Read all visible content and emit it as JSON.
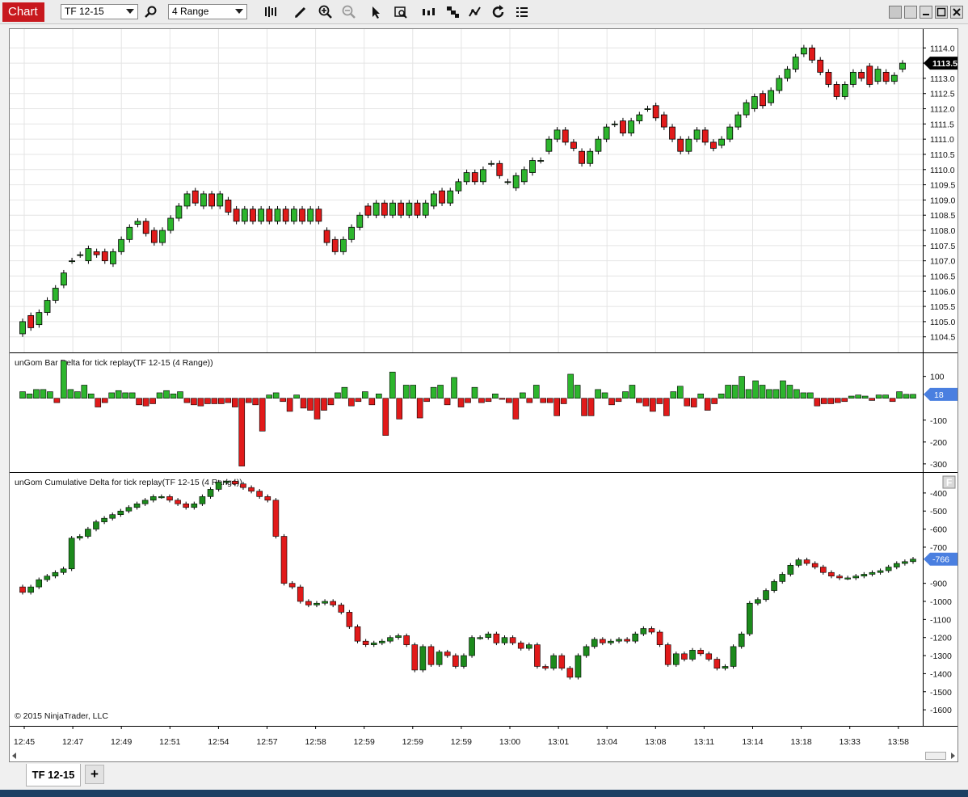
{
  "toolbar": {
    "chart_label": "Chart",
    "instrument": "TF 12-15",
    "period": "4 Range",
    "icons": [
      "search-icon",
      "bars-type-icon",
      "pencil-draw-icon",
      "zoom-in-icon",
      "zoom-out-icon",
      "pointer-icon",
      "data-box-icon",
      "bar-spacing-icon",
      "indicators-icon",
      "strategies-icon",
      "reload-icon",
      "properties-icon"
    ]
  },
  "panels": {
    "price": {
      "axis_labels": [
        "1114.0",
        "1113.5",
        "1113.0",
        "1112.5",
        "1112.0",
        "1111.5",
        "1111.0",
        "1110.5",
        "1110.0",
        "1109.5",
        "1109.0",
        "1108.5",
        "1108.0",
        "1107.5",
        "1107.0",
        "1106.5",
        "1106.0",
        "1105.5",
        "1105.0",
        "1104.5"
      ],
      "last_price": "1113.5"
    },
    "bar_delta": {
      "title": "unGom Bar Delta for tick replay(TF 12-15 (4 Range))",
      "axis_labels": [
        "100",
        "-100",
        "-200",
        "-300"
      ],
      "last_value": "18"
    },
    "cum_delta": {
      "title": "unGom Cumulative Delta for tick replay(TF 12-15 (4 Range))",
      "axis_labels": [
        "-400",
        "-500",
        "-600",
        "-700",
        "-900",
        "-1000",
        "-1100",
        "-1200",
        "-1300",
        "-1400",
        "-1500",
        "-1600"
      ],
      "last_value": "-766",
      "copyright": "© 2015 NinjaTrader, LLC"
    }
  },
  "time_axis": [
    "12:45",
    "12:47",
    "12:49",
    "12:51",
    "12:54",
    "12:57",
    "12:58",
    "12:59",
    "12:59",
    "12:59",
    "13:00",
    "13:01",
    "13:04",
    "13:08",
    "13:11",
    "13:14",
    "13:18",
    "13:33",
    "13:58"
  ],
  "tabs": {
    "active": "TF 12-15",
    "add": "+"
  },
  "colors": {
    "up": "#2db52d",
    "down": "#e11a1a",
    "cum_up": "#1c8a1c",
    "cum_down": "#e11a1a",
    "price_marker": "#000000",
    "indicator_marker": "#4a7fe0",
    "chart_tab": "#c8181e"
  },
  "chart_data": [
    {
      "type": "candlestick",
      "name": "TF 12-15 price",
      "ylim": [
        1104.2,
        1114.3
      ],
      "bar_range": 0.4,
      "close": [
        1105.0,
        1104.8,
        1105.3,
        1105.7,
        1106.1,
        1106.6,
        1107.0,
        1107.2,
        1107.4,
        1107.2,
        1107.0,
        1107.3,
        1107.7,
        1108.1,
        1108.3,
        1107.9,
        1107.6,
        1108.0,
        1108.4,
        1108.8,
        1109.2,
        1108.9,
        1109.2,
        1108.8,
        1109.2,
        1108.6,
        1108.3,
        1108.7,
        1108.3,
        1108.7,
        1108.3,
        1108.7,
        1108.3,
        1108.7,
        1108.3,
        1108.7,
        1108.3,
        1107.6,
        1107.3,
        1107.7,
        1108.1,
        1108.5,
        1108.5,
        1108.9,
        1108.5,
        1108.9,
        1108.5,
        1108.9,
        1108.5,
        1108.9,
        1109.2,
        1108.9,
        1109.3,
        1109.6,
        1109.9,
        1109.6,
        1110.0,
        1110.2,
        1109.8,
        1109.6,
        1109.8,
        1110.0,
        1110.3,
        1110.3,
        1111.0,
        1111.3,
        1110.9,
        1110.7,
        1110.2,
        1110.6,
        1111.0,
        1111.4,
        1111.5,
        1111.2,
        1111.6,
        1111.8,
        1112.0,
        1111.7,
        1111.4,
        1111.0,
        1110.6,
        1111.0,
        1111.3,
        1110.9,
        1110.7,
        1111.0,
        1111.4,
        1111.8,
        1112.2,
        1112.4,
        1112.1,
        1112.6,
        1113.0,
        1113.3,
        1113.7,
        1114.0,
        1113.6,
        1113.2,
        1112.8,
        1112.4,
        1112.8,
        1113.2,
        1113.0,
        1112.8,
        1113.3,
        1112.9,
        1113.1,
        1113.5
      ],
      "open": [
        1104.6,
        1105.2,
        1104.9,
        1105.3,
        1105.7,
        1106.2,
        1107.0,
        1107.2,
        1107.0,
        1107.3,
        1107.3,
        1106.9,
        1107.3,
        1107.7,
        1108.2,
        1108.3,
        1108.0,
        1107.6,
        1108.0,
        1108.4,
        1108.8,
        1109.3,
        1108.8,
        1109.2,
        1108.8,
        1109.0,
        1108.7,
        1108.3,
        1108.7,
        1108.3,
        1108.7,
        1108.3,
        1108.7,
        1108.3,
        1108.7,
        1108.3,
        1108.7,
        1108.0,
        1107.7,
        1107.3,
        1107.7,
        1108.1,
        1108.8,
        1108.5,
        1108.9,
        1108.5,
        1108.9,
        1108.5,
        1108.9,
        1108.5,
        1108.8,
        1109.3,
        1108.9,
        1109.3,
        1109.6,
        1109.9,
        1109.6,
        1110.2,
        1110.2,
        1109.6,
        1109.4,
        1109.6,
        1109.9,
        1110.3,
        1110.6,
        1111.0,
        1111.3,
        1110.9,
        1110.6,
        1110.2,
        1110.6,
        1111.0,
        1111.5,
        1111.6,
        1111.2,
        1111.6,
        1112.0,
        1112.1,
        1111.8,
        1111.4,
        1111.0,
        1110.6,
        1111.0,
        1111.3,
        1110.9,
        1110.8,
        1111.0,
        1111.4,
        1111.8,
        1112.0,
        1112.5,
        1112.2,
        1112.6,
        1113.0,
        1113.3,
        1113.8,
        1114.0,
        1113.6,
        1113.2,
        1112.8,
        1112.4,
        1112.8,
        1113.2,
        1113.4,
        1112.9,
        1113.2,
        1112.9,
        1113.3
      ]
    },
    {
      "type": "bar",
      "name": "unGom Bar Delta",
      "ylim": [
        -330,
        180
      ],
      "values": [
        30,
        20,
        40,
        40,
        30,
        -20,
        170,
        40,
        30,
        60,
        20,
        -40,
        -20,
        25,
        35,
        25,
        25,
        -30,
        -35,
        -25,
        25,
        35,
        20,
        30,
        -20,
        -30,
        -35,
        -25,
        -25,
        -25,
        -20,
        -40,
        -310,
        -20,
        -30,
        -150,
        15,
        25,
        -15,
        -60,
        15,
        -45,
        -55,
        -95,
        -55,
        -30,
        25,
        50,
        -35,
        -15,
        30,
        -30,
        20,
        -170,
        120,
        -95,
        60,
        60,
        -90,
        -15,
        50,
        60,
        -30,
        95,
        -40,
        -20,
        50,
        -20,
        -15,
        20,
        -5,
        -20,
        -95,
        25,
        -20,
        60,
        -20,
        -20,
        -80,
        -25,
        110,
        60,
        -80,
        -80,
        40,
        25,
        -30,
        -15,
        30,
        60,
        -20,
        -35,
        -60,
        -25,
        -80,
        30,
        55,
        -35,
        -40,
        20,
        -55,
        -25,
        20,
        60,
        60,
        100,
        40,
        80,
        60,
        40,
        40,
        80,
        60,
        40,
        25,
        25,
        -35,
        -25,
        -25,
        -20,
        -15,
        10,
        15,
        10,
        -10,
        15,
        15,
        -15,
        30,
        18,
        18
      ]
    },
    {
      "type": "candlestick",
      "name": "unGom Cumulative Delta",
      "ylim": [
        -1680,
        -320
      ],
      "close": [
        -950,
        -920,
        -880,
        -860,
        -840,
        -820,
        -650,
        -640,
        -600,
        -560,
        -540,
        -520,
        -500,
        -480,
        -460,
        -440,
        -420,
        -420,
        -440,
        -460,
        -480,
        -460,
        -420,
        -380,
        -340,
        -335,
        -350,
        -370,
        -390,
        -420,
        -440,
        -640,
        -900,
        -920,
        -1000,
        -1020,
        -1010,
        -1000,
        -1020,
        -1060,
        -1140,
        -1220,
        -1240,
        -1230,
        -1220,
        -1200,
        -1190,
        -1240,
        -1380,
        -1250,
        -1350,
        -1280,
        -1300,
        -1360,
        -1300,
        -1200,
        -1200,
        -1180,
        -1230,
        -1200,
        -1230,
        -1260,
        -1240,
        -1360,
        -1370,
        -1300,
        -1370,
        -1420,
        -1300,
        -1250,
        -1210,
        -1230,
        -1220,
        -1210,
        -1220,
        -1180,
        -1150,
        -1170,
        -1240,
        -1350,
        -1290,
        -1320,
        -1270,
        -1290,
        -1320,
        -1370,
        -1360,
        -1250,
        -1180,
        -1010,
        -990,
        -940,
        -890,
        -850,
        -800,
        -770,
        -790,
        -810,
        -840,
        -860,
        -870,
        -870,
        -860,
        -850,
        -840,
        -830,
        -810,
        -790,
        -780,
        -766
      ]
    }
  ]
}
